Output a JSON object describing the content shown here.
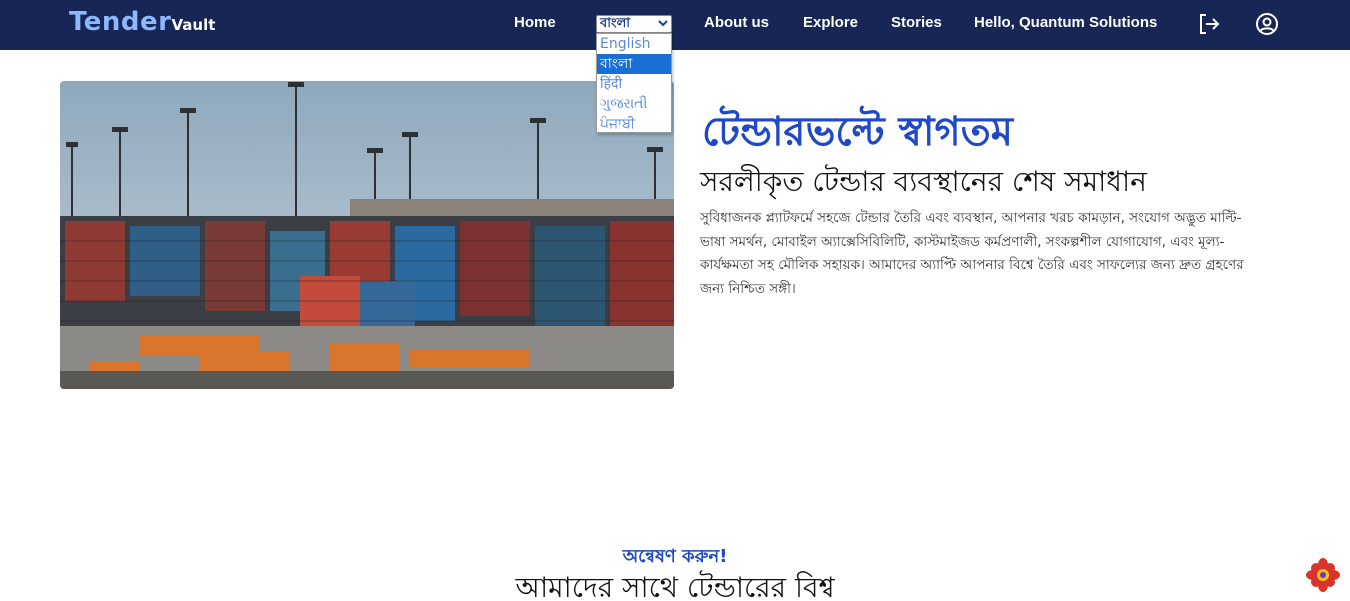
{
  "brand": {
    "name_main": "Tender",
    "name_sub": "Vault",
    "color": "#8bb8ff"
  },
  "navbar": {
    "background": "#172654",
    "home_label": "Home",
    "about_label": "About us",
    "explore_label": "Explore",
    "stories_label": "Stories",
    "greeting": "Hello, Quantum Solutions",
    "logout_icon": "logout-icon",
    "profile_icon": "user-circle-icon"
  },
  "language": {
    "selected": "বাংলা",
    "options": [
      "English",
      "বাংলা",
      "हिंदी",
      "ગુજરાતી",
      "ਪੰਜਾਬੀ"
    ],
    "selected_index": 1
  },
  "hero": {
    "image_alt": "shipping-container-port-photo",
    "title": "টেন্ডারভল্টে স্বাগতম",
    "subtitle": "সরলীকৃত টেন্ডার ব্যবস্থানের শেষ সমাধান",
    "description": "সুবিধাজনক প্ল্যাটফর্মে সহজে টেন্ডার তৈরি এবং ব্যবস্থান, আপনার খরচ কামড়ান, সংযোগ অদ্ভুত মাল্টি-ভাষা সমর্থন, মোবাইল অ্যাক্সেসিবিলিটি, কাস্টমাইজড কর্মপ্রণালী, সংকল্পশীল যোগাযোগ, এবং মূল্য-কার্যক্ষমতা সহ মৌলিক সহায়ক। আমাদের অ্যাপ্টি আপনার বিশ্বে তৈরি এবং সাফল্যের জন্য দ্রুত গ্রহণের জন্য নিশ্চিত সঙ্গী।"
  },
  "explore_section": {
    "kicker": "অন্বেষণ করুন!",
    "title": "আমাদের সাথে টেন্ডারের বিশ্ব"
  },
  "colors": {
    "accent": "#2049c8",
    "dropdown_highlight": "#1a6fd6"
  }
}
